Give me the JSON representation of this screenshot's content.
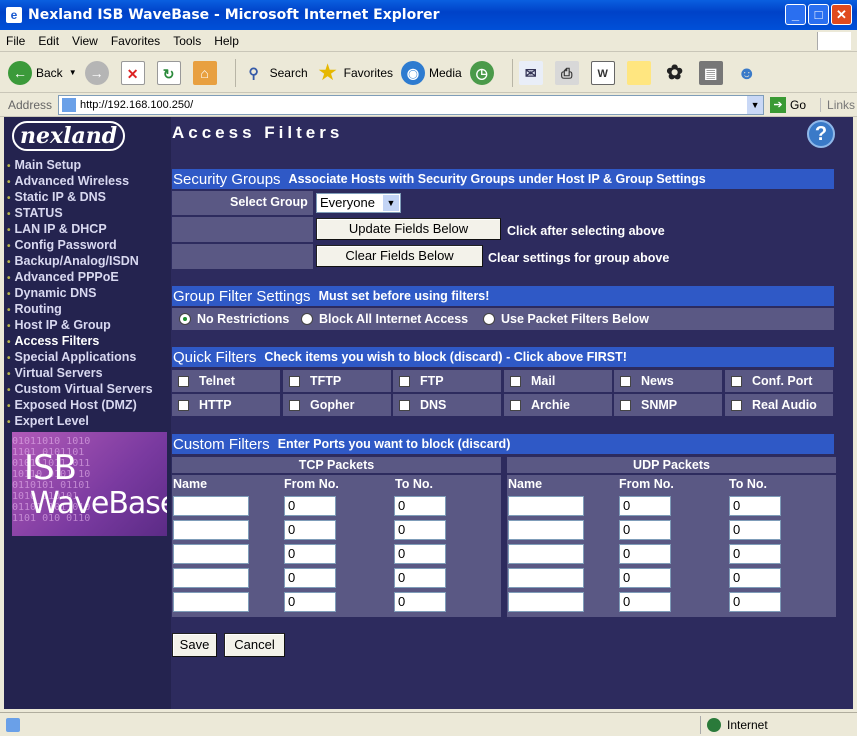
{
  "window": {
    "title": "Nexland ISB WaveBase - Microsoft Internet Explorer"
  },
  "menu": [
    "File",
    "Edit",
    "View",
    "Favorites",
    "Tools",
    "Help"
  ],
  "toolbar": {
    "back": "Back",
    "search": "Search",
    "favorites": "Favorites",
    "media": "Media"
  },
  "address": {
    "label": "Address",
    "url": "http://192.168.100.250/",
    "go": "Go",
    "links": "Links"
  },
  "sidebar": {
    "logo": "nexland",
    "items": [
      "Main Setup",
      "Advanced Wireless",
      "Static IP & DNS",
      "STATUS",
      "LAN IP & DHCP",
      "Config Password",
      "Backup/Analog/ISDN",
      "Advanced PPPoE",
      "Dynamic DNS",
      "Routing",
      "Host IP & Group",
      "Access Filters",
      "Special Applications",
      "Virtual Servers",
      "Custom Virtual Servers",
      "Exposed Host (DMZ)",
      "Expert Level"
    ],
    "active": "Access Filters",
    "banner_line1": "ISB",
    "banner_line2": "WaveBase"
  },
  "page": {
    "title": "Access Filters",
    "help": "?"
  },
  "security_groups": {
    "heading": "Security Groups",
    "subheading": "Associate Hosts with Security Groups under Host IP & Group Settings",
    "select_label": "Select Group",
    "select_value": "Everyone",
    "update_button": "Update Fields Below",
    "update_hint": "Click after selecting above",
    "clear_button": "Clear Fields Below",
    "clear_hint": "Clear settings for group above"
  },
  "group_filter": {
    "heading": "Group Filter Settings",
    "subheading": "Must set before using filters!",
    "options": [
      "No Restrictions",
      "Block All Internet Access",
      "Use Packet Filters Below"
    ],
    "selected": "No Restrictions"
  },
  "quick_filters": {
    "heading": "Quick Filters",
    "subheading": "Check items you wish to block (discard) - Click above FIRST!",
    "items": [
      "Telnet",
      "TFTP",
      "FTP",
      "Mail",
      "News",
      "Conf. Port",
      "HTTP",
      "Gopher",
      "DNS",
      "Archie",
      "SNMP",
      "Real Audio"
    ]
  },
  "custom_filters": {
    "heading": "Custom Filters",
    "subheading": "Enter Ports you want to block (discard)",
    "tcp_title": "TCP Packets",
    "udp_title": "UDP Packets",
    "col_name": "Name",
    "col_from": "From No.",
    "col_to": "To No.",
    "default_port": "0"
  },
  "actions": {
    "save": "Save",
    "cancel": "Cancel"
  },
  "status": {
    "zone": "Internet"
  }
}
